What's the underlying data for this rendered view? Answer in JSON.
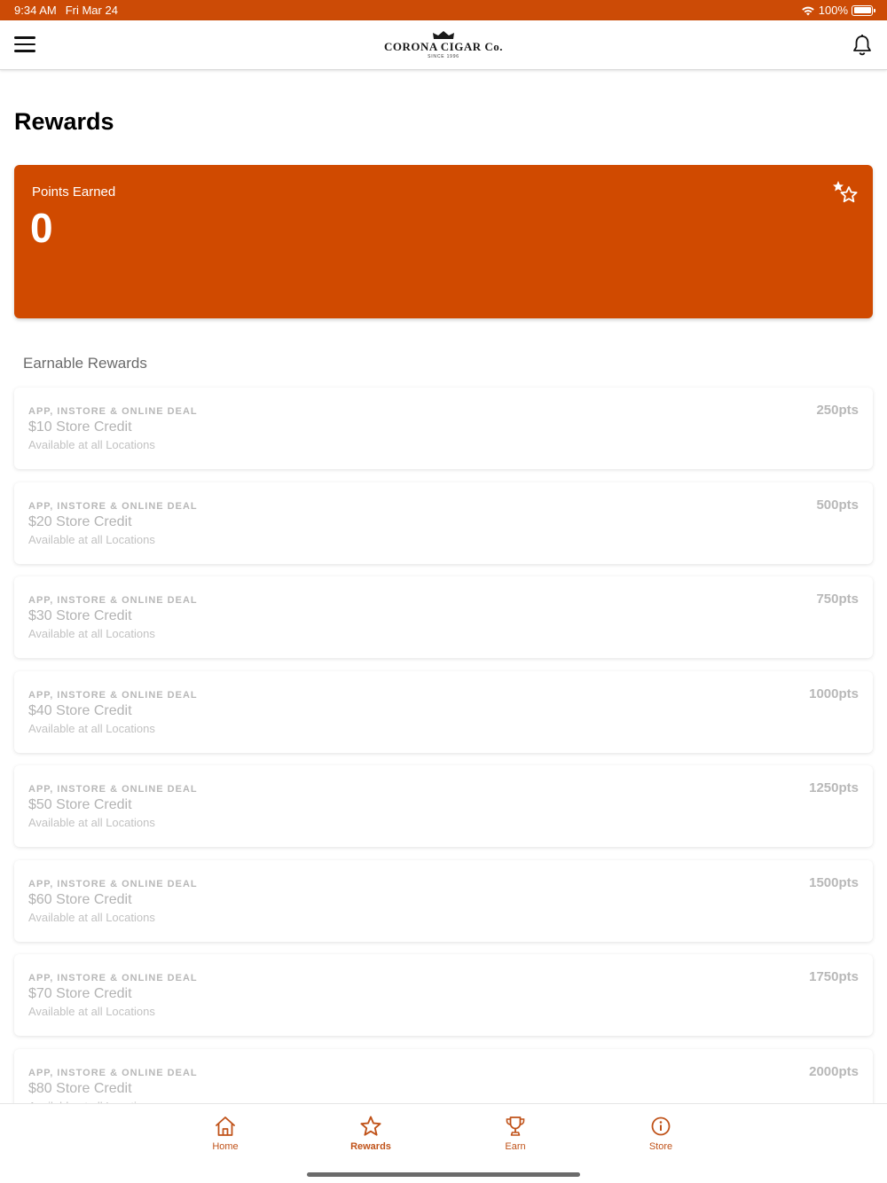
{
  "status_bar": {
    "time": "9:34 AM",
    "date": "Fri Mar 24",
    "battery": "100%"
  },
  "header": {
    "logo_text": "CORONA CIGAR Co.",
    "logo_since": "SINCE 1996",
    "menu_icon": "hamburger-menu-icon",
    "bell_icon": "bell-icon"
  },
  "page": {
    "title": "Rewards"
  },
  "points_card": {
    "label": "Points Earned",
    "value": "0",
    "icon": "stars-icon"
  },
  "section": {
    "title": "Earnable Rewards"
  },
  "rewards": [
    {
      "tag": "APP, INSTORE & ONLINE DEAL",
      "name": "$10 Store Credit",
      "location": "Available at all Locations",
      "points": "250pts"
    },
    {
      "tag": "APP, INSTORE & ONLINE DEAL",
      "name": "$20 Store Credit",
      "location": "Available at all Locations",
      "points": "500pts"
    },
    {
      "tag": "APP, INSTORE & ONLINE DEAL",
      "name": "$30 Store Credit",
      "location": "Available at all Locations",
      "points": "750pts"
    },
    {
      "tag": "APP, INSTORE & ONLINE DEAL",
      "name": "$40 Store Credit",
      "location": "Available at all Locations",
      "points": "1000pts"
    },
    {
      "tag": "APP, INSTORE & ONLINE DEAL",
      "name": "$50 Store Credit",
      "location": "Available at all Locations",
      "points": "1250pts"
    },
    {
      "tag": "APP, INSTORE & ONLINE DEAL",
      "name": "$60 Store Credit",
      "location": "Available at all Locations",
      "points": "1500pts"
    },
    {
      "tag": "APP, INSTORE & ONLINE DEAL",
      "name": "$70 Store Credit",
      "location": "Available at all Locations",
      "points": "1750pts"
    },
    {
      "tag": "APP, INSTORE & ONLINE DEAL",
      "name": "$80 Store Credit",
      "location": "Available at all Locations",
      "points": "2000pts"
    }
  ],
  "tabs": [
    {
      "label": "Home",
      "icon": "home-icon",
      "active": false
    },
    {
      "label": "Rewards",
      "icon": "star-icon",
      "active": true
    },
    {
      "label": "Earn",
      "icon": "trophy-icon",
      "active": false
    },
    {
      "label": "Store",
      "icon": "info-icon",
      "active": false
    }
  ],
  "colors": {
    "brand": "#cc4b06",
    "card": "#d04a00",
    "tab_accent": "#c0531a"
  }
}
